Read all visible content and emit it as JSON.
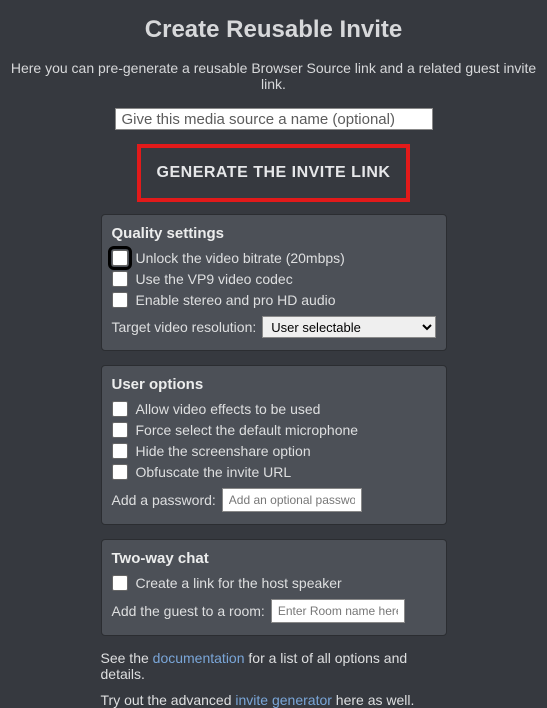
{
  "page": {
    "title": "Create Reusable Invite",
    "description": "Here you can pre-generate a reusable Browser Source link and a related guest invite link."
  },
  "name_input": {
    "placeholder": "Give this media source a name (optional)"
  },
  "generate_button": {
    "label": "GENERATE THE INVITE LINK"
  },
  "quality": {
    "title": "Quality settings",
    "opt_unlock": "Unlock the video bitrate (20mbps)",
    "opt_vp9": "Use the VP9 video codec",
    "opt_stereo": "Enable stereo and pro HD audio",
    "resolution_label": "Target video resolution:",
    "resolution_value": "User selectable"
  },
  "user_options": {
    "title": "User options",
    "opt_effects": "Allow video effects to be used",
    "opt_forcemic": "Force select the default microphone",
    "opt_hidess": "Hide the screenshare option",
    "opt_obfuscate": "Obfuscate the invite URL",
    "password_label": "Add a password:",
    "password_placeholder": "Add an optional password"
  },
  "two_way": {
    "title": "Two-way chat",
    "opt_hostlink": "Create a link for the host speaker",
    "room_label": "Add the guest to a room:",
    "room_placeholder": "Enter Room name here"
  },
  "footer": {
    "line1_a": "See the ",
    "line1_link": "documentation",
    "line1_b": " for a list of all options and details.",
    "line2_a": "Try out the advanced ",
    "line2_link": "invite generator",
    "line2_b": " here as well."
  }
}
